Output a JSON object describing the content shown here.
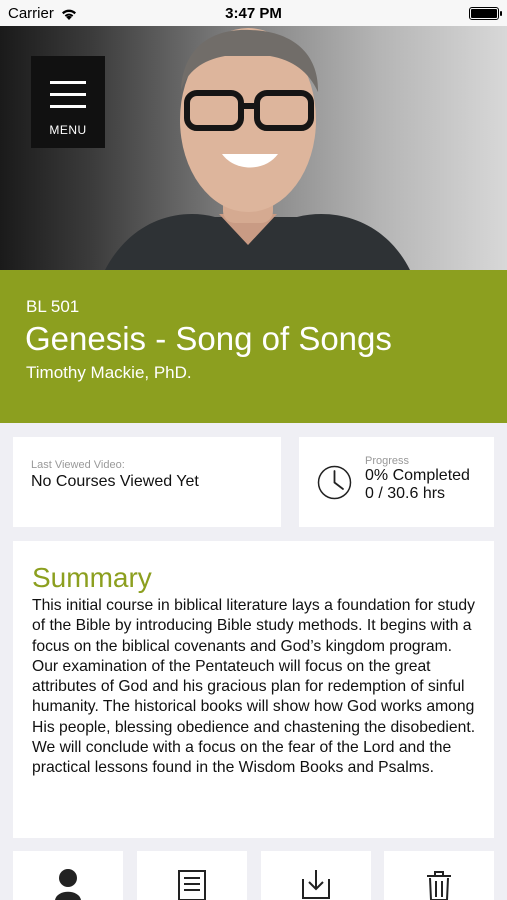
{
  "status_bar": {
    "carrier": "Carrier",
    "time": "3:47 PM"
  },
  "menu": {
    "label": "MENU"
  },
  "course": {
    "code": "BL 501",
    "title": "Genesis - Song of Songs",
    "author": "Timothy Mackie, PhD."
  },
  "last_viewed": {
    "label": "Last Viewed Video:",
    "value": "No Courses Viewed Yet"
  },
  "progress": {
    "label": "Progress",
    "percent_text": "0% Completed",
    "hours_text": "0 / 30.6 hrs",
    "percent": 0
  },
  "summary": {
    "title": "Summary",
    "body": "This initial course in biblical literature lays a foundation for study of the Bible by introducing Bible study methods. It begins with a focus on the biblical covenants and God’s kingdom program. Our examination of the Pentateuch will focus on the great attributes of God and his gracious plan for redemption of sinful humanity. The historical books will show how God works among His people, blessing obedience and chastening the disobedient. We will conclude with a focus on the fear of the Lord and the practical lessons found in the Wisdom Books and Psalms."
  },
  "actions": [
    "person-icon",
    "document-icon",
    "download-icon",
    "trash-icon"
  ],
  "colors": {
    "accent": "#8c9f1f",
    "background": "#efeff4"
  }
}
